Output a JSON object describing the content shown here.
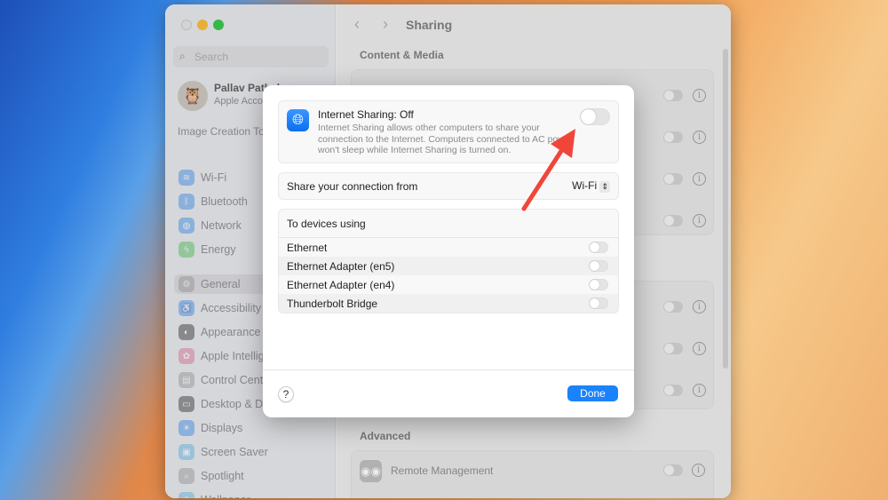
{
  "sidebar": {
    "search_placeholder": "Search",
    "account_name": "Pallav Pathak",
    "account_sub": "Apple Account",
    "promo": "Image Creation Tools Are Here",
    "items": [
      {
        "label": "Wi-Fi",
        "color": "#3b8ef0",
        "glyph": "≋"
      },
      {
        "label": "Bluetooth",
        "color": "#3b8ef0",
        "glyph": "ᛒ"
      },
      {
        "label": "Network",
        "color": "#3b8ef0",
        "glyph": "◍"
      },
      {
        "label": "Energy",
        "color": "#4cc35a",
        "glyph": "ϟ"
      },
      {
        "label": "General",
        "color": "#9a9a9e",
        "glyph": "⚙"
      },
      {
        "label": "Accessibility",
        "color": "#3b8ef0",
        "glyph": "♿"
      },
      {
        "label": "Appearance",
        "color": "#333333",
        "glyph": "◐"
      },
      {
        "label": "Apple Intelligence & Siri",
        "color": "#e0709a",
        "glyph": "✿"
      },
      {
        "label": "Control Center",
        "color": "#9a9a9e",
        "glyph": "▤"
      },
      {
        "label": "Desktop & Dock",
        "color": "#333333",
        "glyph": "▭"
      },
      {
        "label": "Displays",
        "color": "#3b8ef0",
        "glyph": "☀"
      },
      {
        "label": "Screen Saver",
        "color": "#5ab8e8",
        "glyph": "▣"
      },
      {
        "label": "Spotlight",
        "color": "#9a9a9e",
        "glyph": "⌕"
      },
      {
        "label": "Wallpaper",
        "color": "#5ab8e8",
        "glyph": "❀"
      }
    ]
  },
  "main": {
    "title": "Sharing",
    "section_content": "Content & Media",
    "section_advanced": "Advanced",
    "remote_management": "Remote Management"
  },
  "dialog": {
    "title": "Internet Sharing: Off",
    "description": "Internet Sharing allows other computers to share your connection to the Internet. Computers connected to AC power won't sleep while Internet Sharing is turned on.",
    "share_from_label": "Share your connection from",
    "share_from_value": "Wi-Fi",
    "to_devices_label": "To devices using",
    "devices": [
      {
        "label": "Ethernet",
        "on": false
      },
      {
        "label": "Ethernet Adapter (en5)",
        "on": false
      },
      {
        "label": "Ethernet Adapter (en4)",
        "on": false
      },
      {
        "label": "Thunderbolt Bridge",
        "on": false
      }
    ],
    "help": "?",
    "done": "Done",
    "sharing_on": false
  }
}
